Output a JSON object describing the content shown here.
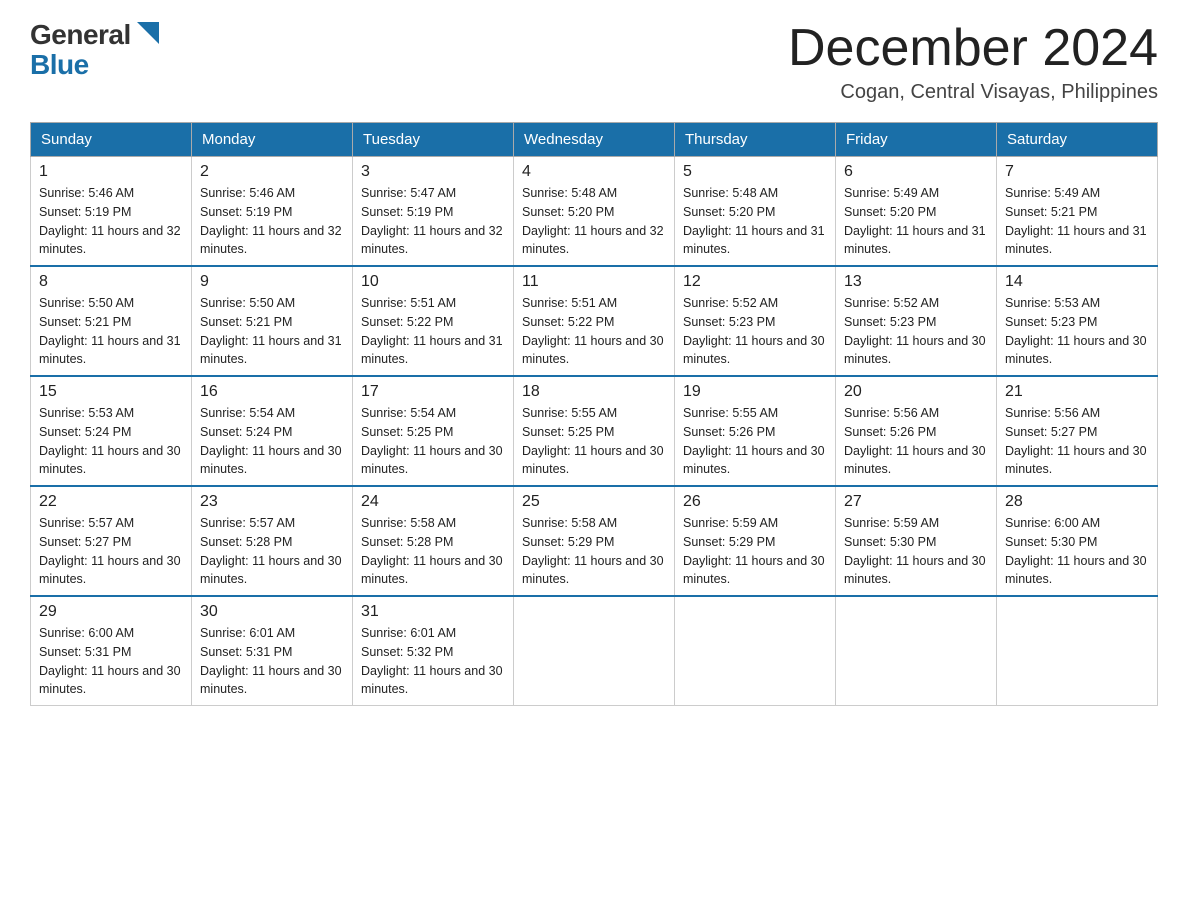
{
  "logo": {
    "general": "General",
    "blue": "Blue"
  },
  "title": "December 2024",
  "location": "Cogan, Central Visayas, Philippines",
  "days_header": [
    "Sunday",
    "Monday",
    "Tuesday",
    "Wednesday",
    "Thursday",
    "Friday",
    "Saturday"
  ],
  "weeks": [
    [
      {
        "day": "1",
        "sunrise": "Sunrise: 5:46 AM",
        "sunset": "Sunset: 5:19 PM",
        "daylight": "Daylight: 11 hours and 32 minutes."
      },
      {
        "day": "2",
        "sunrise": "Sunrise: 5:46 AM",
        "sunset": "Sunset: 5:19 PM",
        "daylight": "Daylight: 11 hours and 32 minutes."
      },
      {
        "day": "3",
        "sunrise": "Sunrise: 5:47 AM",
        "sunset": "Sunset: 5:19 PM",
        "daylight": "Daylight: 11 hours and 32 minutes."
      },
      {
        "day": "4",
        "sunrise": "Sunrise: 5:48 AM",
        "sunset": "Sunset: 5:20 PM",
        "daylight": "Daylight: 11 hours and 32 minutes."
      },
      {
        "day": "5",
        "sunrise": "Sunrise: 5:48 AM",
        "sunset": "Sunset: 5:20 PM",
        "daylight": "Daylight: 11 hours and 31 minutes."
      },
      {
        "day": "6",
        "sunrise": "Sunrise: 5:49 AM",
        "sunset": "Sunset: 5:20 PM",
        "daylight": "Daylight: 11 hours and 31 minutes."
      },
      {
        "day": "7",
        "sunrise": "Sunrise: 5:49 AM",
        "sunset": "Sunset: 5:21 PM",
        "daylight": "Daylight: 11 hours and 31 minutes."
      }
    ],
    [
      {
        "day": "8",
        "sunrise": "Sunrise: 5:50 AM",
        "sunset": "Sunset: 5:21 PM",
        "daylight": "Daylight: 11 hours and 31 minutes."
      },
      {
        "day": "9",
        "sunrise": "Sunrise: 5:50 AM",
        "sunset": "Sunset: 5:21 PM",
        "daylight": "Daylight: 11 hours and 31 minutes."
      },
      {
        "day": "10",
        "sunrise": "Sunrise: 5:51 AM",
        "sunset": "Sunset: 5:22 PM",
        "daylight": "Daylight: 11 hours and 31 minutes."
      },
      {
        "day": "11",
        "sunrise": "Sunrise: 5:51 AM",
        "sunset": "Sunset: 5:22 PM",
        "daylight": "Daylight: 11 hours and 30 minutes."
      },
      {
        "day": "12",
        "sunrise": "Sunrise: 5:52 AM",
        "sunset": "Sunset: 5:23 PM",
        "daylight": "Daylight: 11 hours and 30 minutes."
      },
      {
        "day": "13",
        "sunrise": "Sunrise: 5:52 AM",
        "sunset": "Sunset: 5:23 PM",
        "daylight": "Daylight: 11 hours and 30 minutes."
      },
      {
        "day": "14",
        "sunrise": "Sunrise: 5:53 AM",
        "sunset": "Sunset: 5:23 PM",
        "daylight": "Daylight: 11 hours and 30 minutes."
      }
    ],
    [
      {
        "day": "15",
        "sunrise": "Sunrise: 5:53 AM",
        "sunset": "Sunset: 5:24 PM",
        "daylight": "Daylight: 11 hours and 30 minutes."
      },
      {
        "day": "16",
        "sunrise": "Sunrise: 5:54 AM",
        "sunset": "Sunset: 5:24 PM",
        "daylight": "Daylight: 11 hours and 30 minutes."
      },
      {
        "day": "17",
        "sunrise": "Sunrise: 5:54 AM",
        "sunset": "Sunset: 5:25 PM",
        "daylight": "Daylight: 11 hours and 30 minutes."
      },
      {
        "day": "18",
        "sunrise": "Sunrise: 5:55 AM",
        "sunset": "Sunset: 5:25 PM",
        "daylight": "Daylight: 11 hours and 30 minutes."
      },
      {
        "day": "19",
        "sunrise": "Sunrise: 5:55 AM",
        "sunset": "Sunset: 5:26 PM",
        "daylight": "Daylight: 11 hours and 30 minutes."
      },
      {
        "day": "20",
        "sunrise": "Sunrise: 5:56 AM",
        "sunset": "Sunset: 5:26 PM",
        "daylight": "Daylight: 11 hours and 30 minutes."
      },
      {
        "day": "21",
        "sunrise": "Sunrise: 5:56 AM",
        "sunset": "Sunset: 5:27 PM",
        "daylight": "Daylight: 11 hours and 30 minutes."
      }
    ],
    [
      {
        "day": "22",
        "sunrise": "Sunrise: 5:57 AM",
        "sunset": "Sunset: 5:27 PM",
        "daylight": "Daylight: 11 hours and 30 minutes."
      },
      {
        "day": "23",
        "sunrise": "Sunrise: 5:57 AM",
        "sunset": "Sunset: 5:28 PM",
        "daylight": "Daylight: 11 hours and 30 minutes."
      },
      {
        "day": "24",
        "sunrise": "Sunrise: 5:58 AM",
        "sunset": "Sunset: 5:28 PM",
        "daylight": "Daylight: 11 hours and 30 minutes."
      },
      {
        "day": "25",
        "sunrise": "Sunrise: 5:58 AM",
        "sunset": "Sunset: 5:29 PM",
        "daylight": "Daylight: 11 hours and 30 minutes."
      },
      {
        "day": "26",
        "sunrise": "Sunrise: 5:59 AM",
        "sunset": "Sunset: 5:29 PM",
        "daylight": "Daylight: 11 hours and 30 minutes."
      },
      {
        "day": "27",
        "sunrise": "Sunrise: 5:59 AM",
        "sunset": "Sunset: 5:30 PM",
        "daylight": "Daylight: 11 hours and 30 minutes."
      },
      {
        "day": "28",
        "sunrise": "Sunrise: 6:00 AM",
        "sunset": "Sunset: 5:30 PM",
        "daylight": "Daylight: 11 hours and 30 minutes."
      }
    ],
    [
      {
        "day": "29",
        "sunrise": "Sunrise: 6:00 AM",
        "sunset": "Sunset: 5:31 PM",
        "daylight": "Daylight: 11 hours and 30 minutes."
      },
      {
        "day": "30",
        "sunrise": "Sunrise: 6:01 AM",
        "sunset": "Sunset: 5:31 PM",
        "daylight": "Daylight: 11 hours and 30 minutes."
      },
      {
        "day": "31",
        "sunrise": "Sunrise: 6:01 AM",
        "sunset": "Sunset: 5:32 PM",
        "daylight": "Daylight: 11 hours and 30 minutes."
      },
      null,
      null,
      null,
      null
    ]
  ]
}
